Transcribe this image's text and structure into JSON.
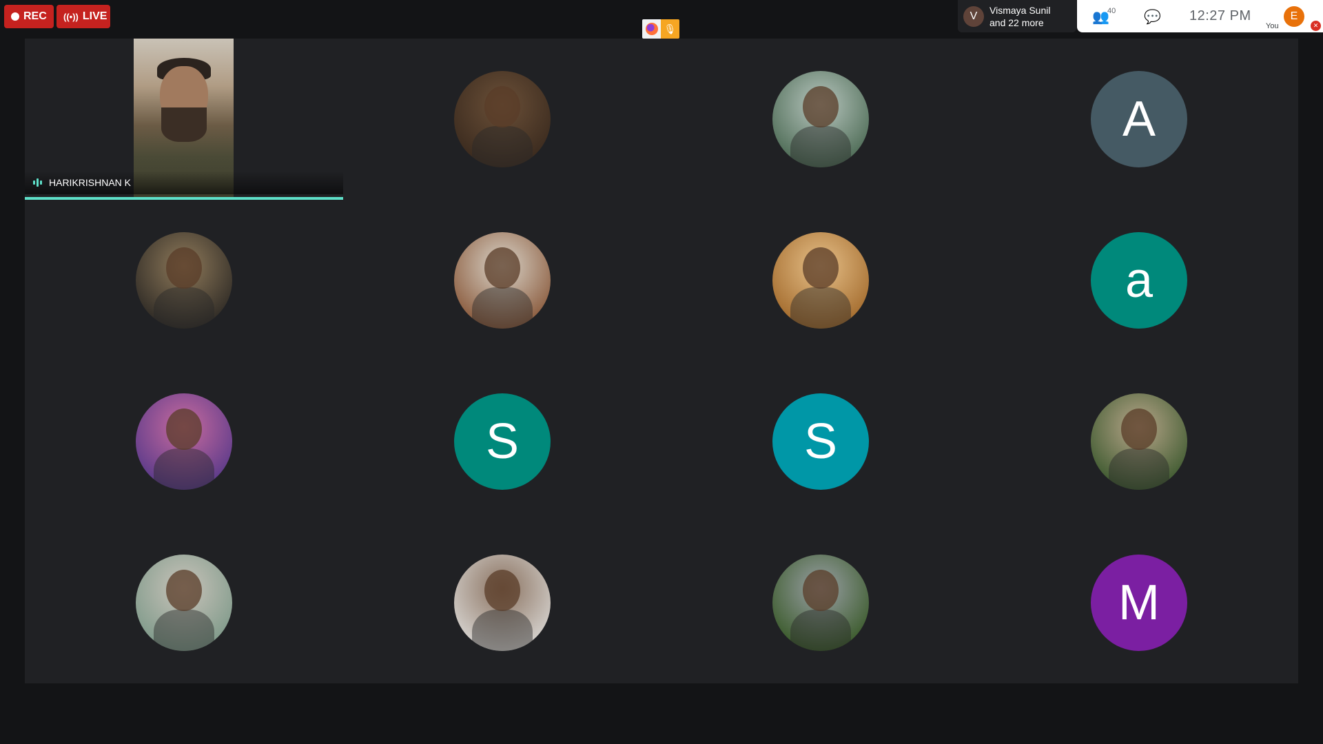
{
  "topbar": {
    "rec_label": "REC",
    "live_label": "LIVE",
    "presenter": {
      "initial": "V",
      "line1": "Vismaya Sunil",
      "line2": "and 22 more"
    },
    "people_count": "40",
    "clock": "12:27  PM",
    "self": {
      "initial": "E",
      "label": "You"
    }
  },
  "tiles": [
    {
      "kind": "video",
      "name": "HARIKRISHNAN K",
      "speaking": true
    },
    {
      "kind": "photo",
      "colors": [
        "#3a2a1e",
        "#6b5038"
      ]
    },
    {
      "kind": "photo",
      "colors": [
        "#4d6b55",
        "#b8c6bf"
      ]
    },
    {
      "kind": "letter",
      "letter": "A",
      "color": "#455a64"
    },
    {
      "kind": "photo",
      "colors": [
        "#2e2a25",
        "#8f7a5a"
      ]
    },
    {
      "kind": "photo",
      "colors": [
        "#8a5a3c",
        "#d9d4c9"
      ]
    },
    {
      "kind": "photo",
      "colors": [
        "#a36b2d",
        "#e6c089"
      ]
    },
    {
      "kind": "letter",
      "letter": "a",
      "color": "#00897b"
    },
    {
      "kind": "photo",
      "colors": [
        "#5a3a8a",
        "#c86b9e"
      ]
    },
    {
      "kind": "letter",
      "letter": "S",
      "color": "#00897b"
    },
    {
      "kind": "letter",
      "letter": "S",
      "color": "#0097a7"
    },
    {
      "kind": "photo",
      "colors": [
        "#3e5a30",
        "#b8a68a"
      ]
    },
    {
      "kind": "photo",
      "colors": [
        "#7f9a8a",
        "#c9c3ba"
      ]
    },
    {
      "kind": "photo",
      "colors": [
        "#d6d3cf",
        "#8a7260"
      ]
    },
    {
      "kind": "photo",
      "colors": [
        "#3a5a2a",
        "#9aa0a6"
      ]
    },
    {
      "kind": "letter",
      "letter": "M",
      "color": "#7b1fa2"
    }
  ]
}
